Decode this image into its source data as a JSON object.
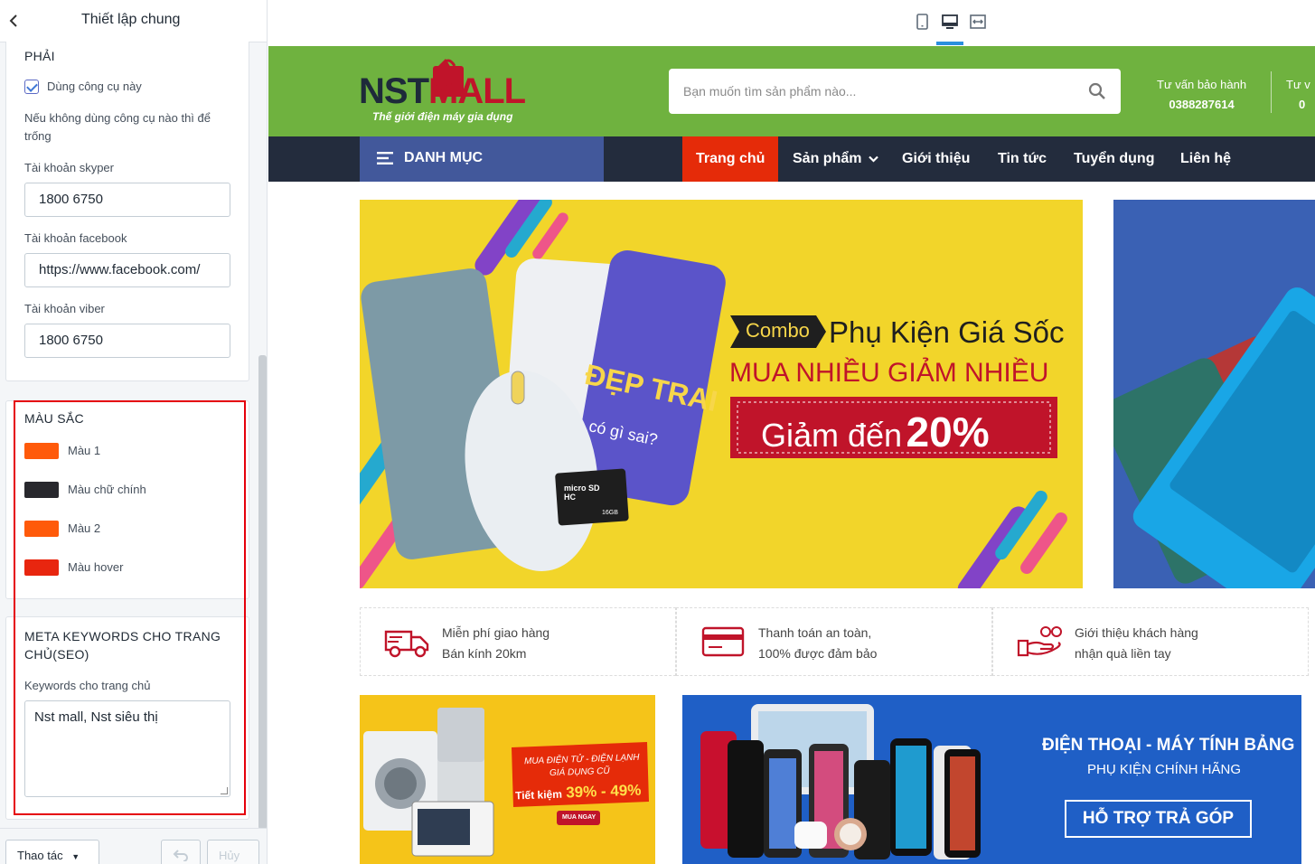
{
  "panel": {
    "title": "Thiết lập chung",
    "section_fragment": "PHẢI",
    "use_tool_label": "Dùng công cụ này",
    "use_tool_checked": true,
    "hint": "Nếu không dùng công cụ nào thì để trống",
    "skype_label": "Tài khoản skyper",
    "skype_value": "1800 6750",
    "facebook_label": "Tài khoản facebook",
    "facebook_value": "https://www.facebook.com/",
    "viber_label": "Tài khoản viber",
    "viber_value": "1800 6750",
    "colors_title": "MÀU SẮC",
    "colors": [
      {
        "label": "Màu 1",
        "hex": "#ff5a0a"
      },
      {
        "label": "Màu chữ chính",
        "hex": "#28282d"
      },
      {
        "label": "Màu 2",
        "hex": "#ff5a0a"
      },
      {
        "label": "Màu hover",
        "hex": "#e8260f"
      }
    ],
    "meta_title": "META KEYWORDS CHO TRANG CHỦ(SEO)",
    "meta_label": "Keywords cho trang chủ",
    "meta_value": "Nst mall, Nst siêu thị",
    "actions_label": "Thao tác",
    "cancel_label": "Hủy"
  },
  "toolbar": {
    "devices": [
      "mobile-icon",
      "desktop-icon",
      "fullwidth-icon"
    ],
    "active_device": "desktop-icon"
  },
  "store": {
    "logo": {
      "nst": "NST",
      "mall": "MALL",
      "tagline": "Thế giới điện máy gia dụng"
    },
    "search_placeholder": "Bạn muốn tìm sản phẩm nào...",
    "hotline1_title": "Tư vấn bảo hành",
    "hotline1_phone": "0388287614",
    "hotline2_title": "Tư v",
    "hotline2_phone": "0",
    "category_label": "DANH MỤC",
    "menu": [
      "Trang chủ",
      "Sản phẩm",
      "Giới thiệu",
      "Tin tức",
      "Tuyển dụng",
      "Liên hệ"
    ],
    "banner": {
      "combo": "Combo",
      "headline": "Phụ Kiện Giá Sốc",
      "subhead": "MUA NHIỀU GIẢM NHIỀU",
      "discount_prefix": "Giảm đến",
      "discount": "20%",
      "case_text": "ĐẸP TRAI",
      "case_sub": "có gì sai?",
      "card_brand": "micro SD HC",
      "card_size": "16GB"
    },
    "features": [
      {
        "line1": "Miễn phí giao hàng",
        "line2": "Bán kính 20km",
        "icon": "truck-icon"
      },
      {
        "line1": "Thanh toán an toàn,",
        "line2": "100% được đảm bảo",
        "icon": "credit-card-icon"
      },
      {
        "line1": "Giới thiệu khách hàng",
        "line2": "nhận quà liền tay",
        "icon": "gift-hand-icon"
      }
    ],
    "promo1": {
      "line1": "MUA ĐIỆN TỬ - ĐIỆN LẠNH",
      "line2": "GIÁ DỤNG CŨ",
      "save": "Tiết kiệm",
      "range": "39% - 49%",
      "cta": "MUA NGAY"
    },
    "promo2": {
      "title": "ĐIỆN THOẠI - MÁY TÍNH BẢNG",
      "subtitle": "PHỤ KIỆN CHÍNH HÃNG",
      "cta": "HỖ TRỢ TRẢ GÓP"
    },
    "colors": {
      "header": "#6fb23f",
      "nav": "#232c3d",
      "category": "#42589b",
      "active_menu": "#e52b09",
      "brand_red": "#c0142a"
    }
  }
}
